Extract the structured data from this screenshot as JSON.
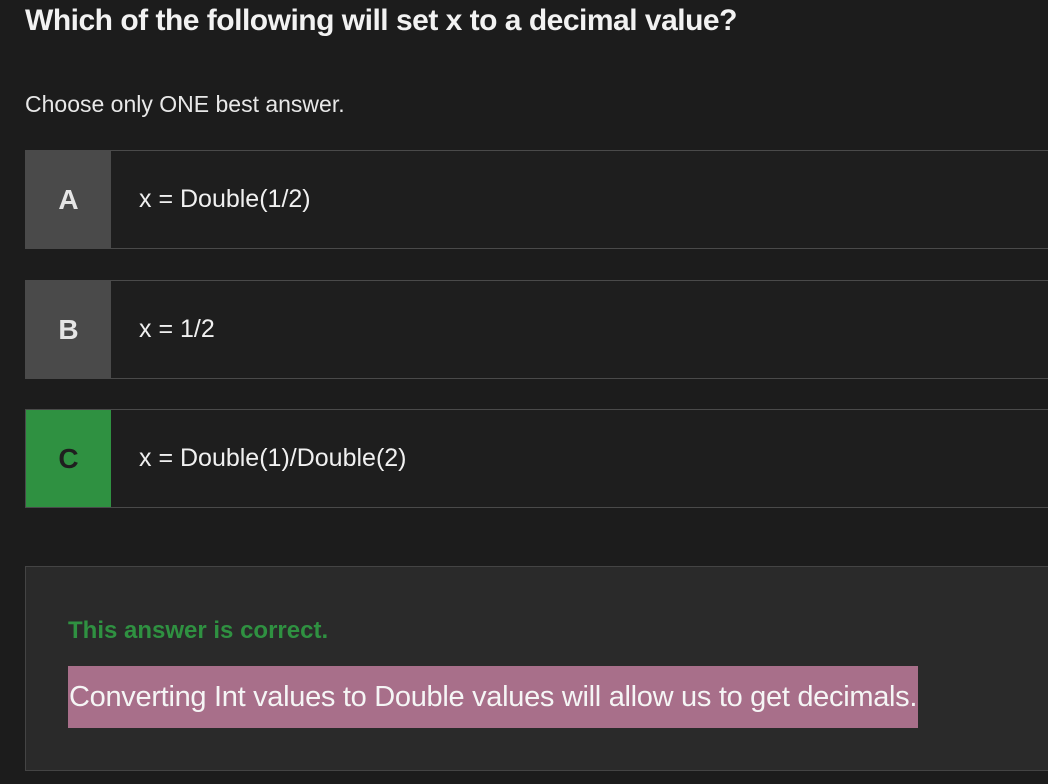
{
  "question": {
    "title": "Which of the following will set x to a decimal value?",
    "instruction": "Choose only ONE best answer."
  },
  "options": [
    {
      "letter": "A",
      "text": "x = Double(1/2)",
      "state": "unselected"
    },
    {
      "letter": "B",
      "text": "x = 1/2",
      "state": "unselected"
    },
    {
      "letter": "C",
      "text": "x = Double(1)/Double(2)",
      "state": "correct"
    }
  ],
  "feedback": {
    "status": "This answer is correct.",
    "explanation": "Converting Int values to Double values will allow us to get decimals."
  },
  "colors": {
    "background": "#1c1c1c",
    "letter_box": "#4a4a4a",
    "correct_green": "#2f9141",
    "highlight": "#a86f8a",
    "feedback_panel": "#2a2a2a"
  }
}
